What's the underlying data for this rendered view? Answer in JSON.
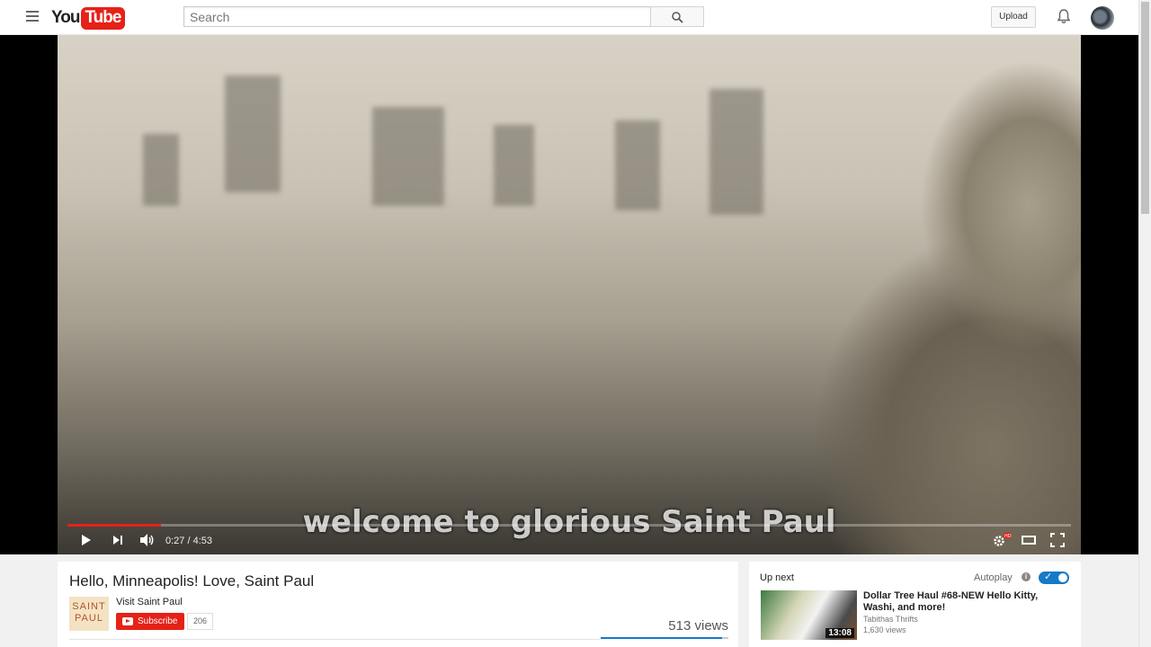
{
  "header": {
    "logo_you": "You",
    "logo_tube": "Tube",
    "search_placeholder": "Search",
    "upload_label": "Upload"
  },
  "player": {
    "subtitle": "welcome to glorious Saint Paul",
    "time_display": "0:27 / 4:53",
    "progress_fraction": 0.093
  },
  "video": {
    "title": "Hello, Minneapolis! Love, Saint Paul",
    "channel_name": "Visit Saint Paul",
    "channel_logo_text": "SAINT PAUL",
    "subscribe_label": "Subscribe",
    "subscriber_count": "206",
    "views": "513 views"
  },
  "sidebar": {
    "up_next_label": "Up next",
    "autoplay_label": "Autoplay",
    "next_video": {
      "title": "Dollar Tree Haul #68-NEW Hello Kitty, Washi, and more!",
      "channel": "Tabithas Thrifts",
      "views": "1,630 views",
      "duration": "13:08"
    }
  },
  "colors": {
    "brand_red": "#e62117",
    "accent_blue": "#167ac6"
  }
}
